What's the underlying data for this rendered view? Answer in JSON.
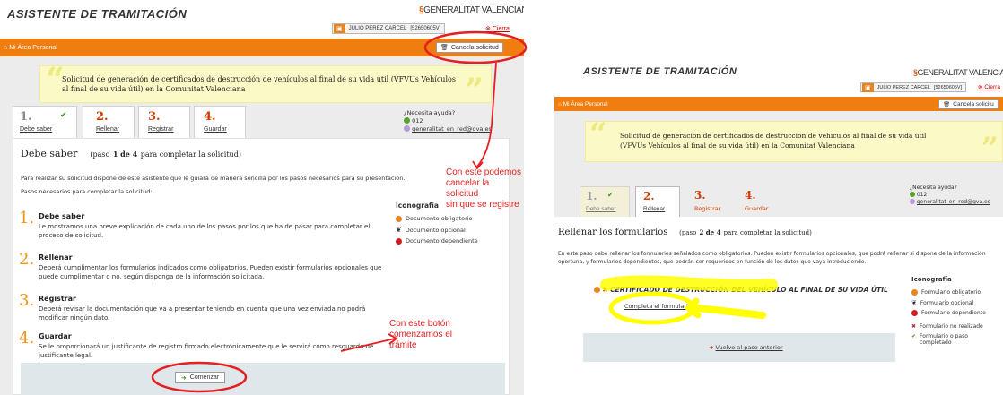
{
  "left": {
    "app_title": "ASISTENTE DE TRAMITACIÓN",
    "logo_text": "GENERALITAT VALENCIANA",
    "user_name": "JULIO PEREZ CARCEL",
    "user_id": "[52650605V]",
    "close_label": "Cierra",
    "area_label": "Mi Área Personal",
    "cancel_label": "Cancela solicitud",
    "procedure_title": "Solicitud de generación de certificados de destrucción de vehículos al final de su vida útil (VFVUs Vehículos al final de su vida útil) en la Comunitat Valenciana",
    "steps": [
      {
        "num": "1.",
        "label": "Debe saber",
        "done": true
      },
      {
        "num": "2.",
        "label": "Rellenar"
      },
      {
        "num": "3.",
        "label": "Registrar"
      },
      {
        "num": "4.",
        "label": "Guardar"
      }
    ],
    "help_title": "¿Necesita ayuda?",
    "help_phone": "012",
    "help_email": "generalitat_en_red@gva.es",
    "section_title": "Debe saber",
    "section_step": "(paso",
    "section_step_num": "1 de 4",
    "section_step_rest": "para completar la solicitud)",
    "intro": "Para realizar su solicitud dispone de este asistente que le guiará de manera sencilla por los pasos necesarios para su presentación.",
    "intro2": "Pasos necesarios para completar la solicitud:",
    "items": [
      {
        "num": "1.",
        "title": "Debe saber",
        "desc": "Le mostramos una breve explicación de cada uno de los pasos por los que ha de pasar para completar el proceso de solicitud."
      },
      {
        "num": "2.",
        "title": "Rellenar",
        "desc": "Deberá cumplimentar los formularios indicados como obligatorios. Pueden existir formularios opcionales que puede cumplimentar o no, según disponga de la información solicitada."
      },
      {
        "num": "3.",
        "title": "Registrar",
        "desc": "Deberá revisar la documentación que va a presentar teniendo en cuenta que una vez enviada no podrá modificar ningún dato."
      },
      {
        "num": "4.",
        "title": "Guardar",
        "desc": "Se le proporcionará un justificante de registro firmado electrónicamente que le servirá como resguardo de justificante legal."
      }
    ],
    "iconografia_title": "Iconografía",
    "icons": [
      {
        "label": "Documento obligatorio",
        "color": "#e8841e"
      },
      {
        "label": "Documento opcional",
        "color": "#555555"
      },
      {
        "label": "Documento dependiente",
        "color": "#cc1f1f"
      }
    ],
    "start_label": "Comenzar"
  },
  "right": {
    "app_title": "ASISTENTE DE TRAMITACIÓN",
    "logo_text": "GENERALITAT VALENCIANA",
    "user_name": "JULIO PEREZ CARCEL",
    "user_id": "[52650605V]",
    "close_label": "Cierra",
    "area_label": "Mi Área Personal",
    "cancel_label": "Cancela solicitu",
    "procedure_title": "Solicitud de generación de certificados de destrucción de vehículos al final de su vida útil (VFVUs Vehículos al final de su vida útil) en la Comunitat Valenciana",
    "steps": [
      {
        "num": "1.",
        "label": "Debe saber",
        "done": true
      },
      {
        "num": "2.",
        "label": "Rellenar"
      },
      {
        "num": "3.",
        "label": "Registrar"
      },
      {
        "num": "4.",
        "label": "Guardar"
      }
    ],
    "help_title": "¿Necesita ayuda?",
    "help_phone": "012",
    "help_email": "generalitat_en_red@gva.es",
    "section_title": "Rellenar los formularios",
    "section_step": "(paso",
    "section_step_num": "2 de 4",
    "section_step_rest": "para completar la solicitud)",
    "intro": "En este paso debe rellenar los formularios señalados como obligatorios. Pueden existir formularios opcionales, que podrá rellenar si dispone de la información oportuna, y formularios dependientes, que podrán ser requeridos en función de los datos que vaya introduciendo.",
    "form_title": "CERTIFICADO DE DESTRUCCIÓN DEL VEHÍCULO AL FINAL DE SU VIDA ÚTIL",
    "form_link": "Completa el formulario",
    "back_label": "Vuelve al paso anterior",
    "iconografia_title": "Iconografía",
    "icons": [
      {
        "label": "Formulario obligatorio",
        "color": "#e8841e"
      },
      {
        "label": "Formulario opcional",
        "color": "#555555"
      },
      {
        "label": "Formulario dependiente",
        "color": "#cc1f1f"
      },
      {
        "label": "Formulario no realizado",
        "color": "#cc1f1f"
      },
      {
        "label": "Formulario o paso completado",
        "color": "#3a9a14"
      }
    ]
  },
  "annotations": {
    "cancel_note": [
      "Con este podemos",
      "cancelar la solicitud",
      "sin que se registre"
    ],
    "start_note": [
      "Con este botón",
      "comenzamos el",
      "trámite"
    ]
  },
  "colors": {
    "accent": "#ef7d10",
    "annotation": "#e52020",
    "highlight": "#ffff00"
  }
}
